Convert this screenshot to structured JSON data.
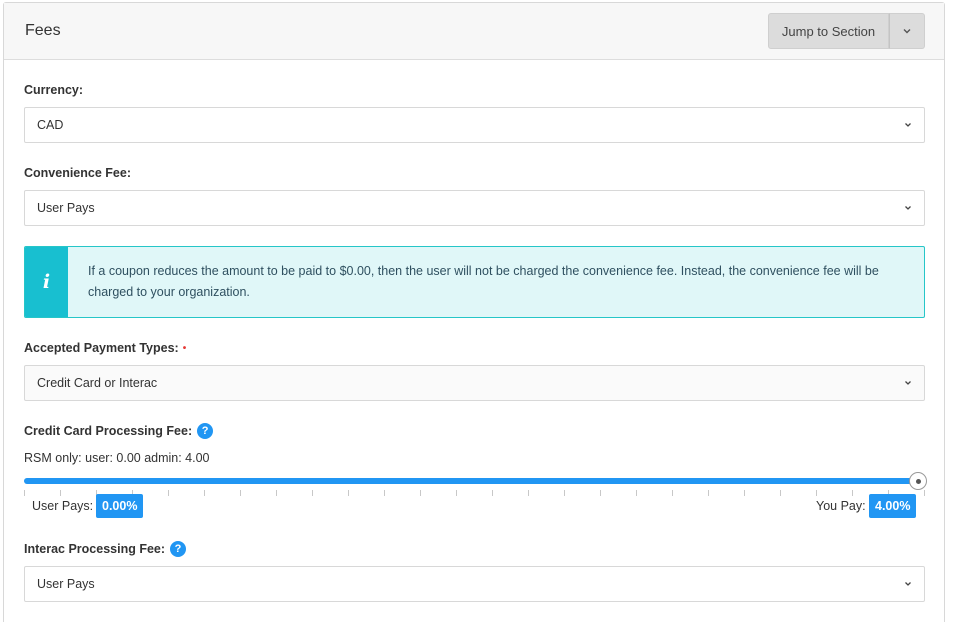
{
  "panel": {
    "title": "Fees",
    "jump_label": "Jump to Section"
  },
  "currency": {
    "label": "Currency:",
    "value": "CAD"
  },
  "convenience_fee": {
    "label": "Convenience Fee:",
    "value": "User Pays"
  },
  "info": {
    "icon": "info-icon",
    "text": "If a coupon reduces the amount to be paid to $0.00, then the user will not be charged the convenience fee. Instead, the convenience fee will be charged to your organization."
  },
  "payment_types": {
    "label": "Accepted Payment Types:",
    "required_marker": "•",
    "value": "Credit Card or Interac"
  },
  "credit_card_fee": {
    "label": "Credit Card Processing Fee:",
    "help": "?",
    "note": "RSM only: user: 0.00 admin: 4.00",
    "slider_fraction": 1.0,
    "tick_count": 26,
    "user_pays_label": "User Pays:",
    "user_pays_value": "0.00%",
    "you_pay_label": "You Pay:",
    "you_pay_value": "4.00%"
  },
  "interac_fee": {
    "label": "Interac Processing Fee:",
    "help": "?",
    "value": "User Pays"
  },
  "colors": {
    "accent": "#2196f3",
    "info_strip": "#18bfd0",
    "info_bg": "#e0f7f8",
    "required": "#e53935"
  }
}
